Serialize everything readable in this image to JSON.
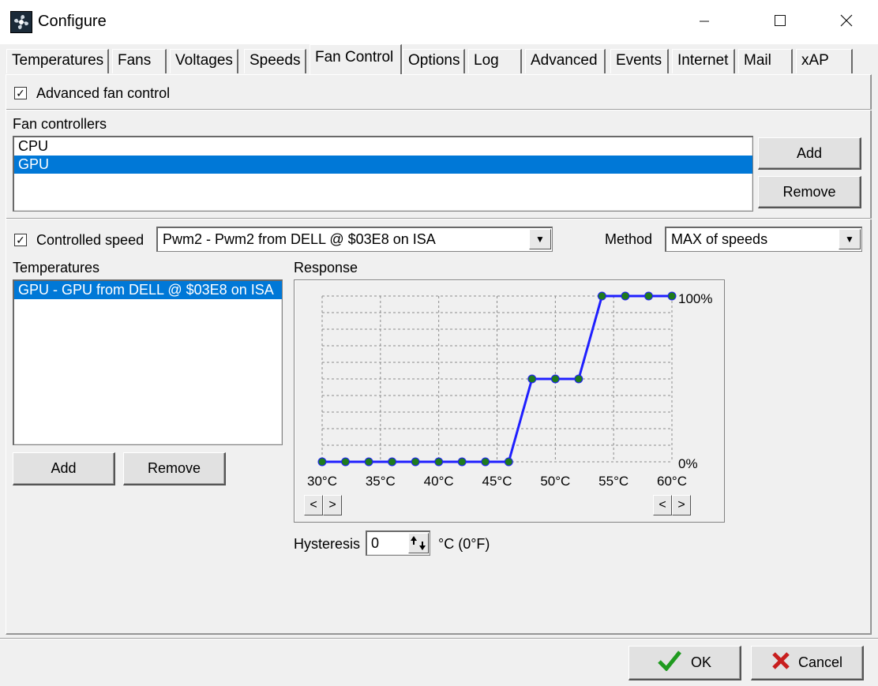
{
  "window": {
    "title": "Configure",
    "minimize_icon": "minimize-icon",
    "maximize_icon": "maximize-icon",
    "close_icon": "close-icon"
  },
  "tabs": [
    {
      "label": "Temperatures"
    },
    {
      "label": "Fans"
    },
    {
      "label": "Voltages"
    },
    {
      "label": "Speeds"
    },
    {
      "label": "Fan Control",
      "active": true
    },
    {
      "label": "Options"
    },
    {
      "label": "Log"
    },
    {
      "label": "Advanced"
    },
    {
      "label": "Events"
    },
    {
      "label": "Internet"
    },
    {
      "label": "Mail"
    },
    {
      "label": "xAP"
    }
  ],
  "advanced": {
    "label": "Advanced fan control",
    "checked": true
  },
  "fan_controllers": {
    "label": "Fan controllers",
    "items": [
      {
        "label": "CPU",
        "selected": false
      },
      {
        "label": "GPU",
        "selected": true
      }
    ],
    "add_label": "Add",
    "remove_label": "Remove"
  },
  "controlled": {
    "label": "Controlled speed",
    "checked": true,
    "speed_value": "Pwm2 - Pwm2 from DELL @ $03E8 on ISA",
    "method_label": "Method",
    "method_value": "MAX of speeds"
  },
  "temperatures": {
    "label": "Temperatures",
    "items": [
      {
        "label": "GPU - GPU from DELL @ $03E8 on ISA",
        "selected": true
      }
    ],
    "add_label": "Add",
    "remove_label": "Remove"
  },
  "response": {
    "label": "Response",
    "top_label": "100%",
    "bottom_label": "0%",
    "left_nav_prev": "<",
    "left_nav_next": ">",
    "right_nav_prev": "<",
    "right_nav_next": ">"
  },
  "hysteresis": {
    "label": "Hysteresis",
    "value": "0",
    "unit": "°C (0°F)",
    "spin_icon": "up-down-arrows-icon"
  },
  "footer": {
    "ok_label": "OK",
    "ok_icon": "checkmark-icon",
    "cancel_label": "Cancel",
    "cancel_icon": "x-icon"
  },
  "chart_data": {
    "type": "line",
    "x_labels": [
      "30°C",
      "35°C",
      "40°C",
      "45°C",
      "50°C",
      "55°C",
      "60°C"
    ],
    "xlim": [
      30,
      60
    ],
    "ylim": [
      0,
      100
    ],
    "grid": true,
    "line_color": "#1f1fff",
    "point_color": "#1e7a1e",
    "series": [
      {
        "x": [
          30,
          32,
          34,
          36,
          38,
          40,
          42,
          44,
          46,
          48,
          50,
          52,
          54,
          56,
          58,
          60
        ],
        "y": [
          0,
          0,
          0,
          0,
          0,
          0,
          0,
          0,
          0,
          50,
          50,
          50,
          100,
          100,
          100,
          100
        ]
      }
    ]
  }
}
